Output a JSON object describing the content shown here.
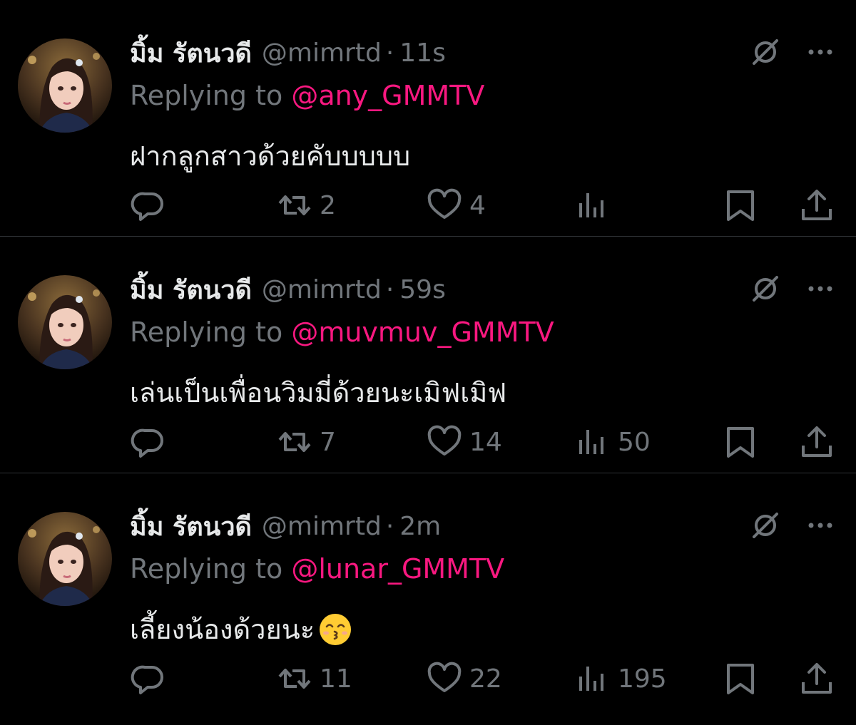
{
  "colors": {
    "background": "#000000",
    "primary_text": "#e7e9ea",
    "secondary_text": "#71767b",
    "mention": "#f91880",
    "divider": "#2f3336"
  },
  "icons": {
    "reply": "reply-icon",
    "retweet": "retweet-icon",
    "like": "heart-icon",
    "views": "views-icon",
    "bookmark": "bookmark-icon",
    "share": "share-icon",
    "grok": "grok-icon",
    "more": "more-icon"
  },
  "tweets": [
    {
      "display_name": "มิ้ม รัตนวดี",
      "handle": "@mimrtd",
      "dot": "·",
      "time": "11s",
      "replying_prefix": "Replying to ",
      "replying_to": "@any_GMMTV",
      "text": "ฝากลูกสาวด้วยคับบบบบ",
      "emoji": "",
      "replies": "",
      "retweets": "2",
      "likes": "4",
      "views": ""
    },
    {
      "display_name": "มิ้ม รัตนวดี",
      "handle": "@mimrtd",
      "dot": "·",
      "time": "59s",
      "replying_prefix": "Replying to ",
      "replying_to": "@muvmuv_GMMTV",
      "text": "เล่นเป็นเพื่อนวิมมี่ด้วยนะเมิฟเมิฟ",
      "emoji": "",
      "replies": "",
      "retweets": "7",
      "likes": "14",
      "views": "50"
    },
    {
      "display_name": "มิ้ม รัตนวดี",
      "handle": "@mimrtd",
      "dot": "·",
      "time": "2m",
      "replying_prefix": "Replying to ",
      "replying_to": "@lunar_GMMTV",
      "text": "เลี้ยงน้องด้วยนะ",
      "emoji": "kissing-face-with-smiling-eyes",
      "replies": "",
      "retweets": "11",
      "likes": "22",
      "views": "195"
    }
  ]
}
